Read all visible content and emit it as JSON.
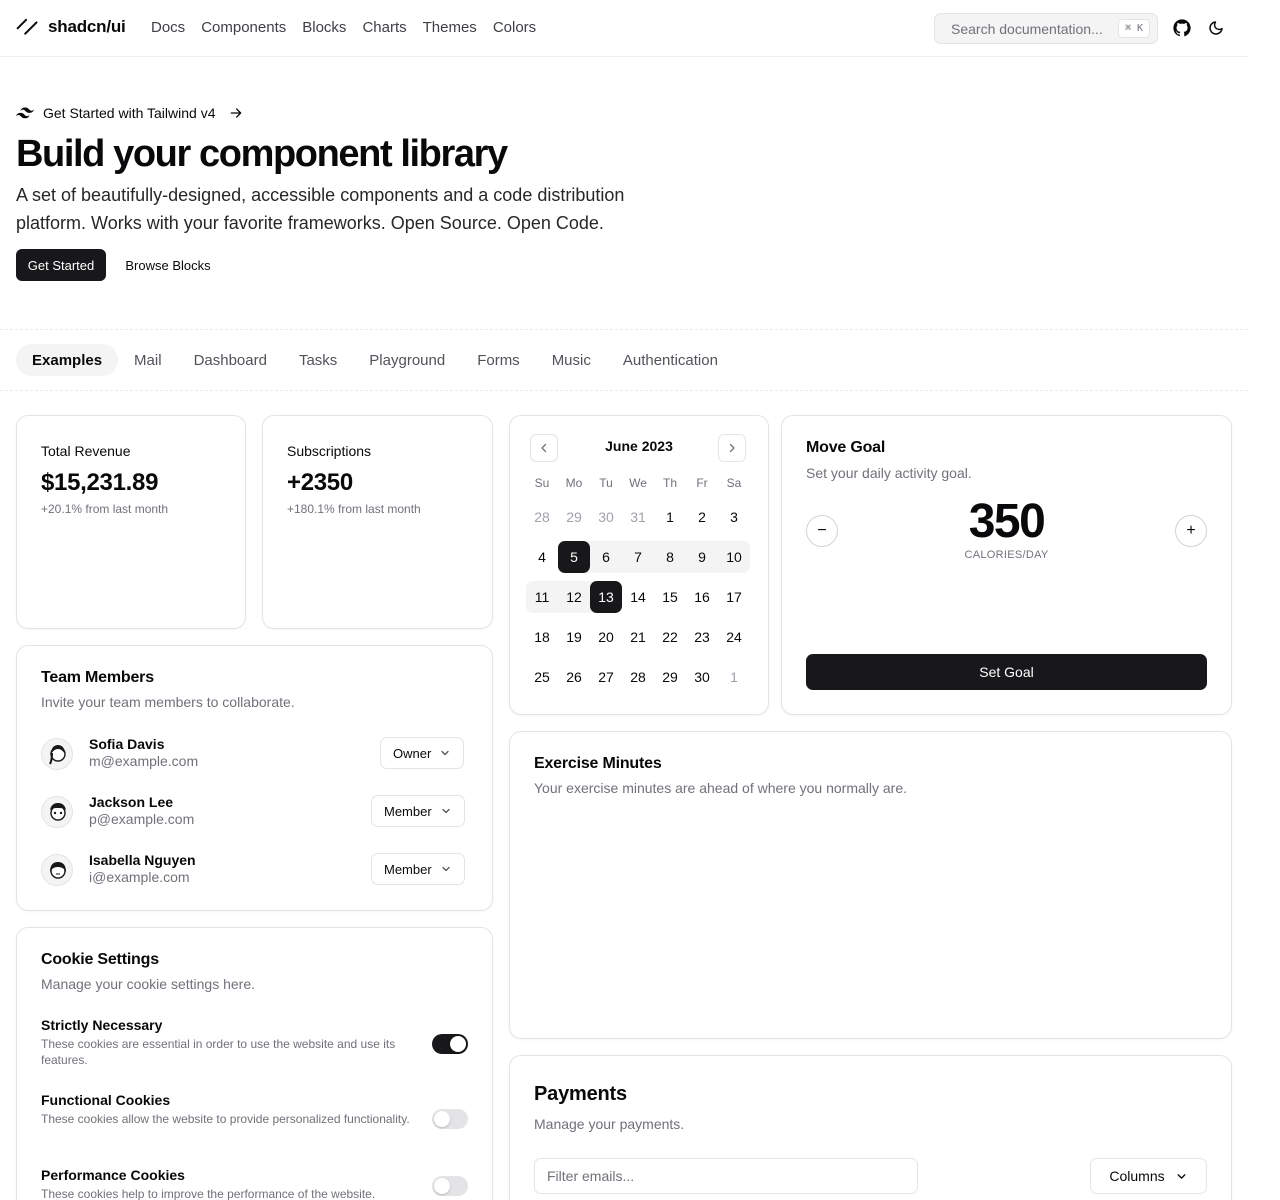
{
  "header": {
    "brand": "shadcn/ui",
    "nav": [
      "Docs",
      "Components",
      "Blocks",
      "Charts",
      "Themes",
      "Colors"
    ],
    "search_placeholder": "Search documentation...",
    "search_shortcut": "⌘ K"
  },
  "hero": {
    "announcement": "Get Started with Tailwind v4",
    "title": "Build your component library",
    "subtitle": "A set of beautifully-designed, accessible components and a code distribution platform. Works with your favorite frameworks. Open Source. Open Code.",
    "primary_button": "Get Started",
    "secondary_button": "Browse Blocks"
  },
  "tabs": [
    "Examples",
    "Mail",
    "Dashboard",
    "Tasks",
    "Playground",
    "Forms",
    "Music",
    "Authentication"
  ],
  "active_tab": "Examples",
  "revenue": {
    "label": "Total Revenue",
    "value": "$15,231.89",
    "change": "+20.1% from last month"
  },
  "subscriptions": {
    "label": "Subscriptions",
    "value": "+2350",
    "change": "+180.1% from last month"
  },
  "calendar": {
    "month": "June 2023",
    "weekdays": [
      "Su",
      "Mo",
      "Tu",
      "We",
      "Th",
      "Fr",
      "Sa"
    ],
    "weeks": [
      [
        "28",
        "29",
        "30",
        "31",
        "1",
        "2",
        "3"
      ],
      [
        "4",
        "5",
        "6",
        "7",
        "8",
        "9",
        "10"
      ],
      [
        "11",
        "12",
        "13",
        "14",
        "15",
        "16",
        "17"
      ],
      [
        "18",
        "19",
        "20",
        "21",
        "22",
        "23",
        "24"
      ],
      [
        "25",
        "26",
        "27",
        "28",
        "29",
        "30",
        "1"
      ]
    ],
    "selected": [
      "5",
      "13"
    ]
  },
  "goal": {
    "title": "Move Goal",
    "description": "Set your daily activity goal.",
    "value": "350",
    "unit": "CALORIES/DAY",
    "minus": "−",
    "plus": "+",
    "button": "Set Goal"
  },
  "team": {
    "title": "Team Members",
    "description": "Invite your team members to collaborate.",
    "members": [
      {
        "name": "Sofia Davis",
        "email": "m@example.com",
        "role": "Owner"
      },
      {
        "name": "Jackson Lee",
        "email": "p@example.com",
        "role": "Member"
      },
      {
        "name": "Isabella Nguyen",
        "email": "i@example.com",
        "role": "Member"
      }
    ]
  },
  "exercise": {
    "title": "Exercise Minutes",
    "description": "Your exercise minutes are ahead of where you normally are."
  },
  "cookies": {
    "title": "Cookie Settings",
    "description": "Manage your cookie settings here.",
    "items": [
      {
        "title": "Strictly Necessary",
        "desc": "These cookies are essential in order to use the website and use its features.",
        "enabled": true
      },
      {
        "title": "Functional Cookies",
        "desc": "These cookies allow the website to provide personalized functionality.",
        "enabled": false
      },
      {
        "title": "Performance Cookies",
        "desc": "These cookies help to improve the performance of the website.",
        "enabled": false
      }
    ]
  },
  "payments": {
    "title": "Payments",
    "description": "Manage your payments.",
    "filter_placeholder": "Filter emails...",
    "columns_button": "Columns"
  },
  "icons": {
    "logo": "slash-logo-icon",
    "github": "github-icon",
    "theme": "moon-icon",
    "tailwind": "tailwind-icon",
    "arrow": "arrow-right-icon"
  }
}
